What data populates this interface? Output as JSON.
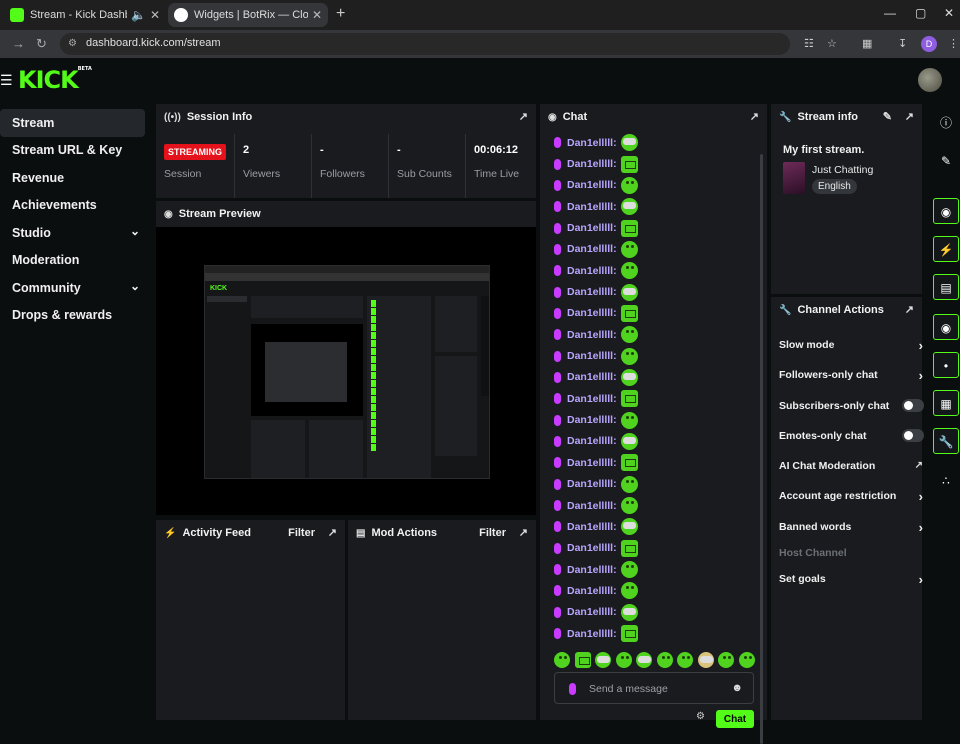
{
  "browser": {
    "tabs": [
      {
        "title": "Stream - Kick Dashboard",
        "favicon_color": "#53fc18"
      },
      {
        "title": "Widgets | BotRix — Cloud Strea",
        "favicon_color": "#ffffff"
      }
    ],
    "url": "dashboard.kick.com/stream",
    "profile_initial": "D"
  },
  "app": {
    "logo": "KICK",
    "logo_sup": "BETA",
    "accent": "#53fc18"
  },
  "sidebar": {
    "items": [
      {
        "label": "Stream",
        "active": true
      },
      {
        "label": "Stream URL & Key"
      },
      {
        "label": "Revenue"
      },
      {
        "label": "Achievements"
      },
      {
        "label": "Studio",
        "has_chevron": true
      },
      {
        "label": "Moderation"
      },
      {
        "label": "Community",
        "has_chevron": true
      },
      {
        "label": "Drops & rewards"
      }
    ]
  },
  "session_info": {
    "title": "Session Info",
    "badge": "STREAMING",
    "stats": [
      {
        "value": "",
        "label": "Session"
      },
      {
        "value": "2",
        "label": "Viewers"
      },
      {
        "value": "-",
        "label": "Followers"
      },
      {
        "value": "-",
        "label": "Sub Counts"
      },
      {
        "value": "00:06:12",
        "label": "Time Live"
      }
    ]
  },
  "stream_preview": {
    "title": "Stream Preview"
  },
  "activity_feed": {
    "title": "Activity Feed",
    "filter": "Filter"
  },
  "mod_actions": {
    "title": "Mod Actions",
    "filter": "Filter"
  },
  "chat": {
    "title": "Chat",
    "username": "Dan1elllll:",
    "message_count": 24,
    "emote_pattern": [
      "e1",
      "e2",
      "e3",
      "e1",
      "e2",
      "e3",
      "e3",
      "e1",
      "e2",
      "e3",
      "e3",
      "e1",
      "e2",
      "e3",
      "e1",
      "e2",
      "e3",
      "e3",
      "e1",
      "e2",
      "e3",
      "e3",
      "e1",
      "e2"
    ],
    "input_placeholder": "Send a message",
    "send_label": "Chat",
    "username_color": "#b9a5ff"
  },
  "stream_info": {
    "title": "Stream info",
    "stream_title": "My first stream.",
    "category": "Just Chatting",
    "language": "English"
  },
  "channel_actions": {
    "title": "Channel Actions",
    "items": [
      {
        "label": "Slow mode",
        "control": "chevron"
      },
      {
        "label": "Followers-only chat",
        "control": "chevron"
      },
      {
        "label": "Subscribers-only chat",
        "control": "toggle"
      },
      {
        "label": "Emotes-only chat",
        "control": "toggle"
      },
      {
        "label": "AI Chat Moderation",
        "control": "external"
      },
      {
        "label": "Account age restriction",
        "control": "chevron"
      },
      {
        "label": "Banned words",
        "control": "chevron"
      },
      {
        "label": "Host Channel",
        "control": "none",
        "disabled": true
      },
      {
        "label": "Set goals",
        "control": "chevron"
      }
    ]
  },
  "rail": {
    "icons": [
      "info-icon",
      "pencil-icon",
      "camera-icon",
      "bolt-icon",
      "document-icon",
      "chat-bubble-icon",
      "broadcast-icon",
      "user-card-icon",
      "wrench-icon",
      "dots-icon"
    ]
  }
}
